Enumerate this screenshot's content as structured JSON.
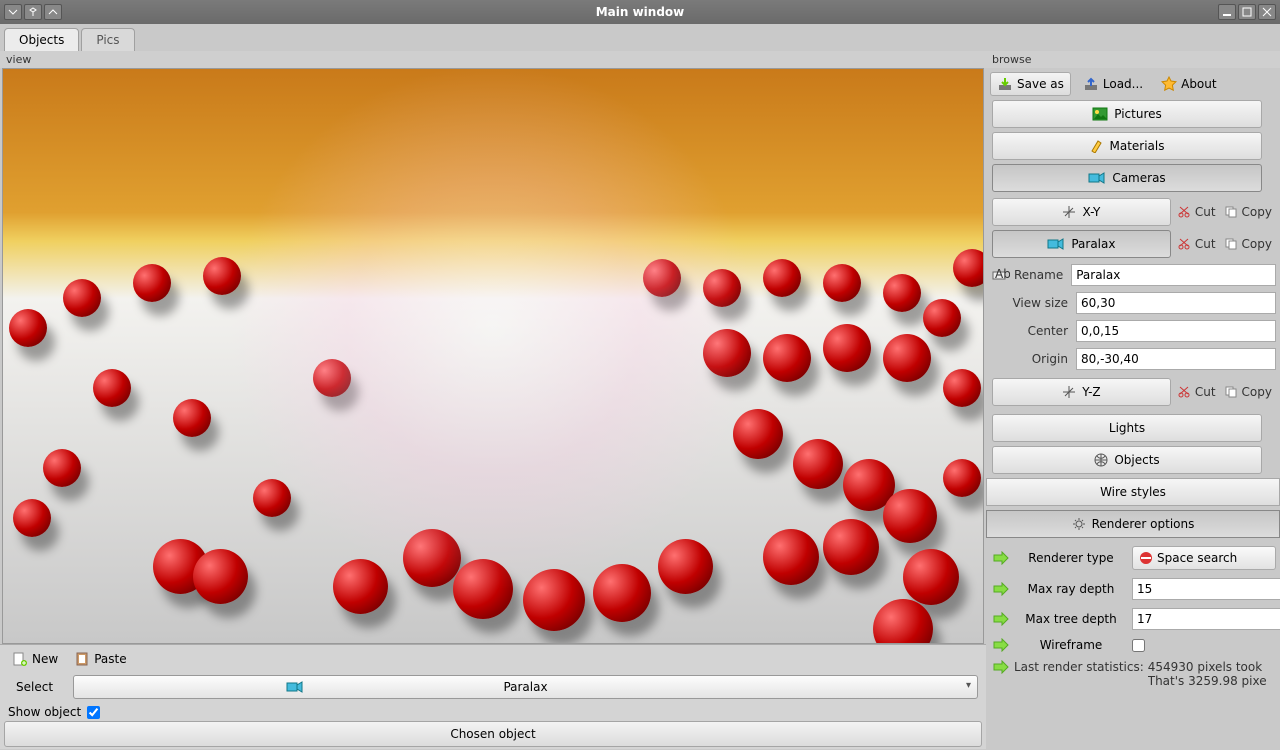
{
  "title": "Main window",
  "tabs": {
    "objects": "Objects",
    "pics": "Pics"
  },
  "left": {
    "view_label": "view",
    "new_btn": "New",
    "paste_btn": "Paste",
    "select_label": "Select",
    "select_value": "Paralax",
    "show_object_label": "Show object",
    "show_object_checked": true,
    "chosen_object_btn": "Chosen object"
  },
  "browse": {
    "label": "browse",
    "save_as": "Save as",
    "load": "Load...",
    "about": "About",
    "pictures": "Pictures",
    "materials": "Materials",
    "cameras": "Cameras",
    "xy": "X-Y",
    "paralax": "Paralax",
    "yz": "Y-Z",
    "cut": "Cut",
    "copy": "Copy",
    "rename_label": "Rename",
    "rename_value": "Paralax",
    "view_size_label": "View size",
    "view_size_value": "60,30",
    "center_label": "Center",
    "center_value": "0,0,15",
    "origin_label": "Origin",
    "origin_value": "80,-30,40",
    "lights": "Lights",
    "objects": "Objects",
    "wire_styles": "Wire styles",
    "renderer_options": "Renderer options",
    "renderer_type_label": "Renderer type",
    "renderer_type_value": "Space search",
    "max_ray_depth_label": "Max ray depth",
    "max_ray_depth_value": "15",
    "max_tree_depth_label": "Max tree depth",
    "max_tree_depth_value": "17",
    "wireframe_label": "Wireframe",
    "wireframe_checked": false,
    "stats_label": "Last render statistics:",
    "stats_line1": "454930 pixels took",
    "stats_line2": "That's 3259.98 pixe"
  }
}
